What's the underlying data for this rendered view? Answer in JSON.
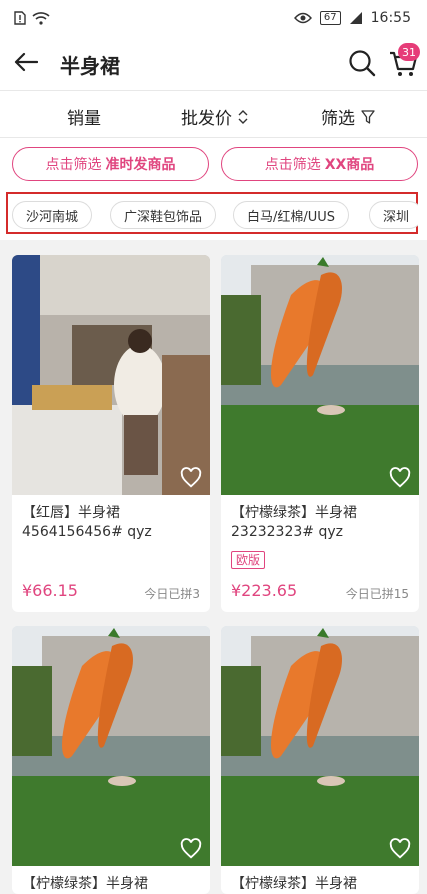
{
  "status": {
    "battery": "67",
    "time": "16:55"
  },
  "header": {
    "title": "半身裙",
    "cart_count": "31"
  },
  "sort": {
    "sales": "销量",
    "price": "批发价",
    "filter": "筛选"
  },
  "filters": [
    {
      "prefix": "点击筛选",
      "highlight": "准时发商品"
    },
    {
      "prefix": "点击筛选",
      "highlight": "XX商品"
    }
  ],
  "markets": [
    "沙河南城",
    "广深鞋包饰品",
    "白马/红棉/UUS",
    "深圳"
  ],
  "products": [
    {
      "name": "【红唇】半身裙4564156456# qyz",
      "badge": "",
      "price": "¥66.15",
      "sold": "今日已拼3"
    },
    {
      "name": "【柠檬绿茶】半身裙23232323# qyz",
      "badge": "欧版",
      "price": "¥223.65",
      "sold": "今日已拼15"
    },
    {
      "name": "【柠檬绿茶】半身裙",
      "badge": "",
      "price": "",
      "sold": ""
    },
    {
      "name": "【柠檬绿茶】半身裙",
      "badge": "",
      "price": "",
      "sold": ""
    }
  ],
  "colors": {
    "accent": "#e0457f",
    "highlight_box": "#d42b2b"
  }
}
